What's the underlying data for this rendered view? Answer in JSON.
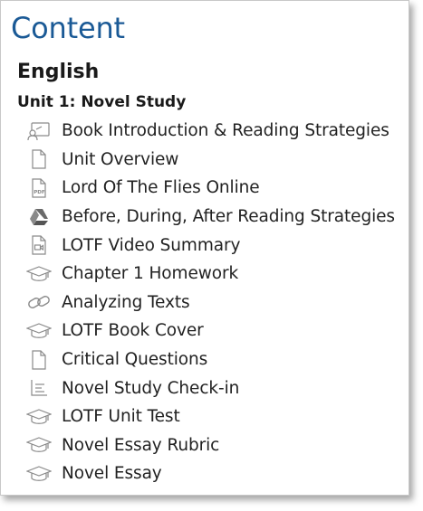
{
  "panel": {
    "title": "Content",
    "course": "English",
    "unit": "Unit 1: Novel Study"
  },
  "items": [
    {
      "label": "Book Introduction & Reading Strategies",
      "icon": "presentation-icon"
    },
    {
      "label": "Unit Overview",
      "icon": "document-icon"
    },
    {
      "label": "Lord Of The Flies Online",
      "icon": "pdf-icon"
    },
    {
      "label": "Before, During, After Reading Strategies",
      "icon": "google-drive-icon"
    },
    {
      "label": "LOTF Video Summary",
      "icon": "video-file-icon"
    },
    {
      "label": "Chapter 1 Homework",
      "icon": "graduation-cap-icon"
    },
    {
      "label": "Analyzing Texts",
      "icon": "link-icon"
    },
    {
      "label": "LOTF Book Cover",
      "icon": "graduation-cap-icon"
    },
    {
      "label": "Critical Questions",
      "icon": "document-icon"
    },
    {
      "label": "Novel Study Check-in",
      "icon": "checklist-icon"
    },
    {
      "label": "LOTF Unit Test",
      "icon": "graduation-cap-icon"
    },
    {
      "label": "Novel Essay Rubric",
      "icon": "graduation-cap-icon"
    },
    {
      "label": "Novel Essay",
      "icon": "graduation-cap-icon"
    }
  ],
  "colors": {
    "title": "#1b5a96",
    "icon_stroke": "#8a8a8a",
    "text": "#222222"
  },
  "pdf_badge_text": "PDF"
}
